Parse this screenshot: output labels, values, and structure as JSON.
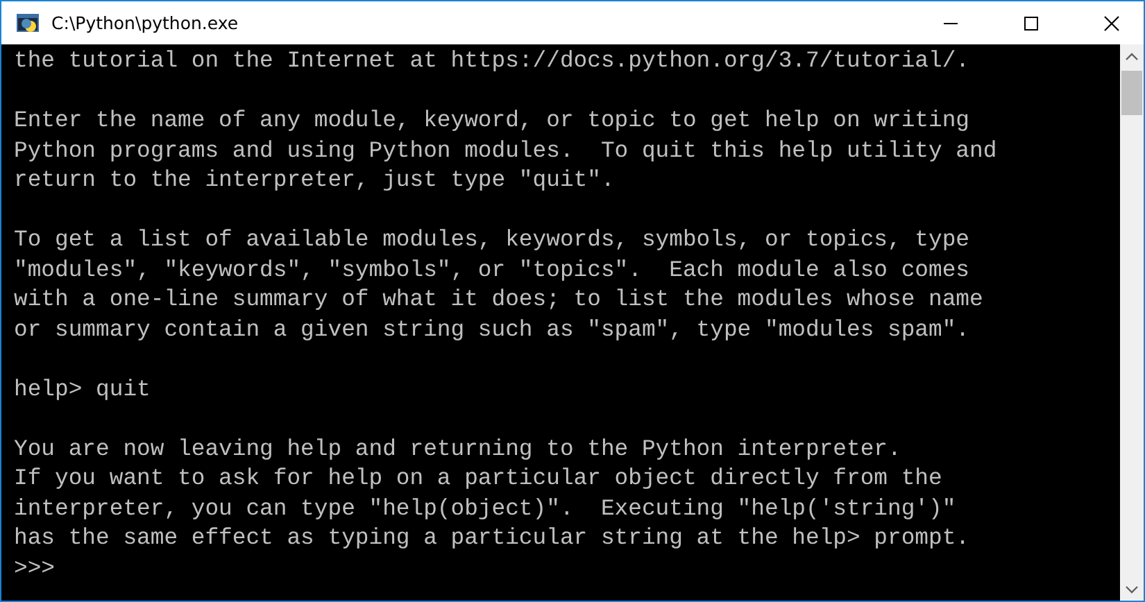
{
  "window": {
    "title": "C:\\Python\\python.exe"
  },
  "console": {
    "blocks": [
      {
        "lines": [
          "the tutorial on the Internet at https://docs.python.org/3.7/tutorial/."
        ]
      },
      {
        "lines": [
          "Enter the name of any module, keyword, or topic to get help on writing",
          "Python programs and using Python modules.  To quit this help utility and",
          "return to the interpreter, just type \"quit\"."
        ]
      },
      {
        "lines": [
          "To get a list of available modules, keywords, symbols, or topics, type",
          "\"modules\", \"keywords\", \"symbols\", or \"topics\".  Each module also comes",
          "with a one-line summary of what it does; to list the modules whose name",
          "or summary contain a given string such as \"spam\", type \"modules spam\"."
        ]
      },
      {
        "lines": [
          "help> quit"
        ]
      },
      {
        "lines": [
          "You are now leaving help and returning to the Python interpreter.",
          "If you want to ask for help on a particular object directly from the",
          "interpreter, you can type \"help(object)\".  Executing \"help('string')\"",
          "has the same effect as typing a particular string at the help> prompt.",
          ">>>"
        ]
      }
    ]
  }
}
